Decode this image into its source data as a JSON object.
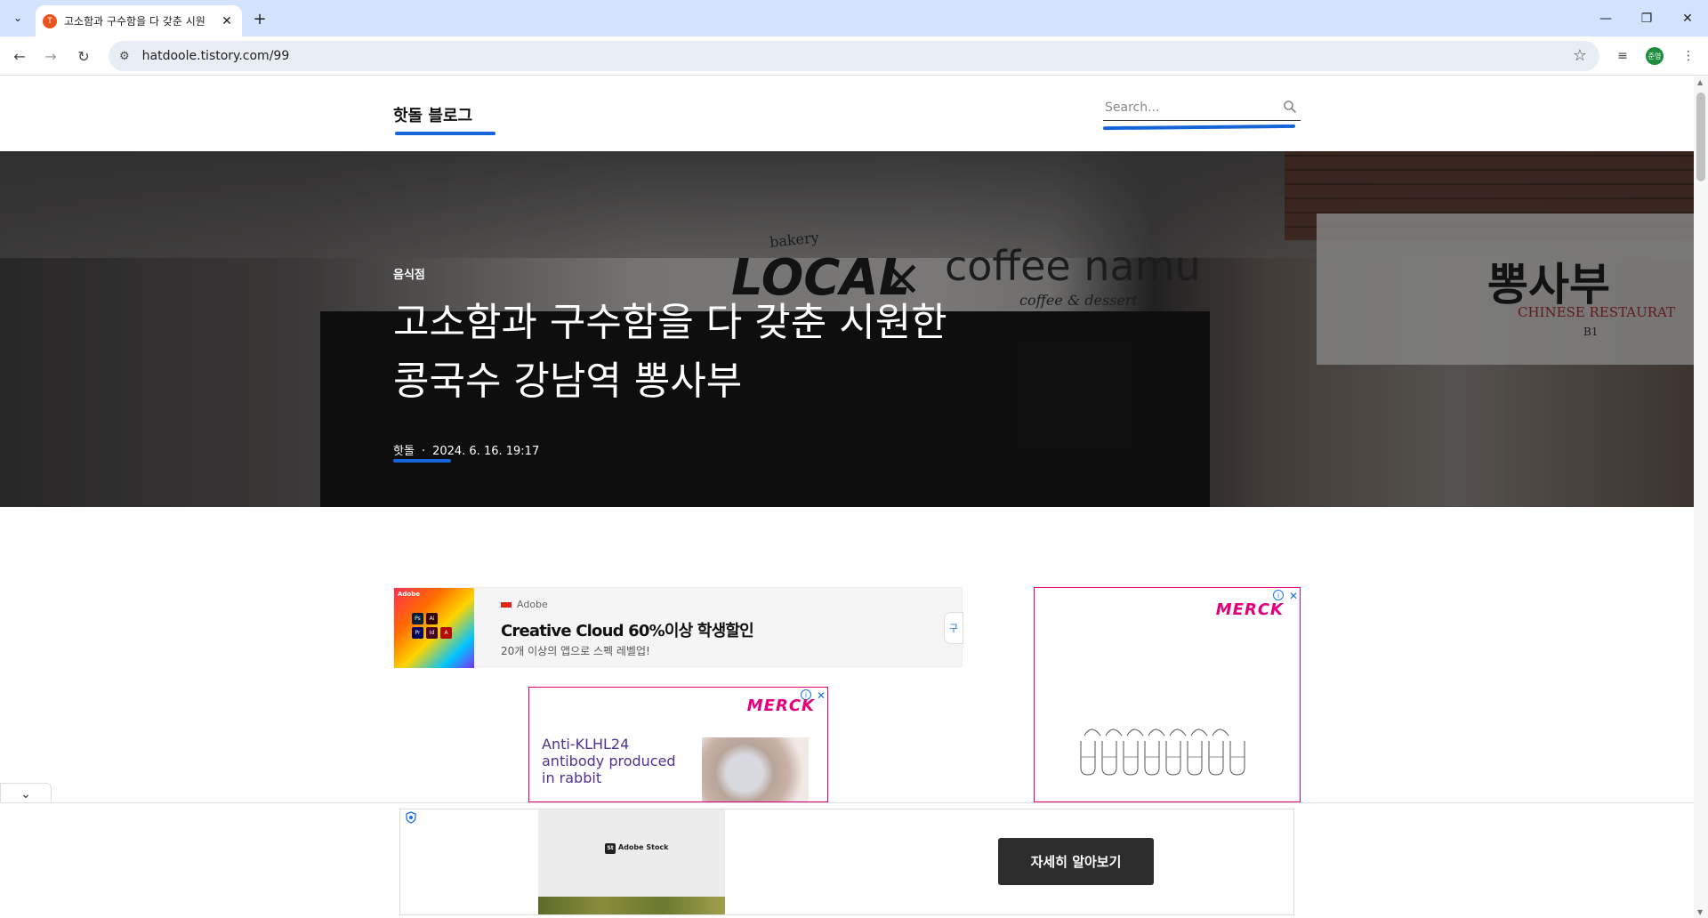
{
  "browser": {
    "tab_title": "고소함과 구수함을 다 갖춘 시원",
    "tab_favicon_letter": "T",
    "url": "hatdoole.tistory.com/99",
    "profile_initials": "준영"
  },
  "blog": {
    "title": "핫돌 블로그",
    "search_placeholder": "Search..."
  },
  "post": {
    "category": "음식점",
    "title_line1": "고소함과 구수함을 다 갖춘 시원한",
    "title_line2": "콩국수 강남역 뽕사부",
    "author": "핫돌",
    "separator": "·",
    "date": "2024. 6. 16. 19:17"
  },
  "hero_signs": {
    "bakery": "bakery",
    "local": "LOCAL",
    "x": "×",
    "coffee_namu": "coffee namu",
    "coffee_dessert": "coffee & dessert",
    "bbong_sabu": "뽕사부",
    "chinese_restaurant": "CHINESE RESTAURAT",
    "b1": "B1"
  },
  "ads": {
    "adobe": {
      "mini_brand": "Adobe",
      "brand": "Adobe",
      "headline": "Creative Cloud 60%이상 학생할인",
      "sub": "20개 이상의 앱으로 스펙 레벨업!",
      "cta_glyph": "구"
    },
    "merck_small": {
      "logo": "MERCK",
      "text": "Anti-KLHL24 antibody produced in rabbit"
    },
    "merck_right": {
      "logo": "MERCK"
    },
    "bottom": {
      "stock_label": "Adobe Stock",
      "stock_badge": "St",
      "button": "자세히 알아보기"
    }
  },
  "colors": {
    "accent_underline": "#1565d8",
    "merck_magenta": "#e4007c",
    "tab_bar": "#d3e3fd"
  }
}
